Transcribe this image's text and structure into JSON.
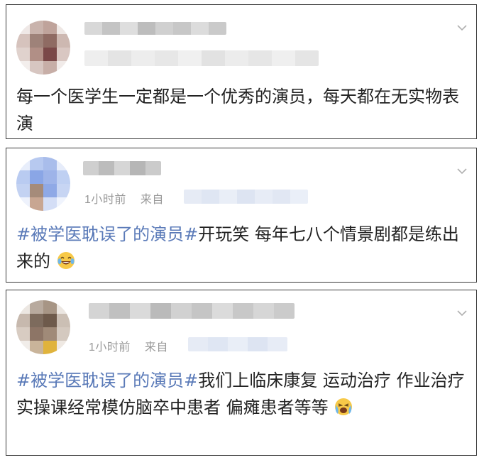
{
  "posts": [
    {
      "meta_time": "",
      "meta_from": "",
      "text_hashtag": "",
      "text_body": "每一个医学生一定都是一个优秀的演员，每天都在无实物表演",
      "emoji": ""
    },
    {
      "meta_time": "1小时前",
      "meta_from": "来自",
      "text_hashtag": "#被学医耽误了的演员#",
      "text_body": "开玩笑 每年七八个情景剧都是练出来的",
      "emoji": "laughing-crying-emoji"
    },
    {
      "meta_time": "1小时前",
      "meta_from": "来自",
      "text_hashtag": "#被学医耽误了的演员#",
      "text_body": "我们上临床康复 运动治疗 作业治疗实操课经常模仿脑卒中患者 偏瘫患者等等",
      "emoji": "crying-laughing-emoji"
    }
  ],
  "icons": {
    "chevron": "chevron-down-icon"
  },
  "colors": {
    "hashtag": "#5a7ab8",
    "meta": "#999999",
    "text": "#222222",
    "border": "#3a3a3a"
  }
}
